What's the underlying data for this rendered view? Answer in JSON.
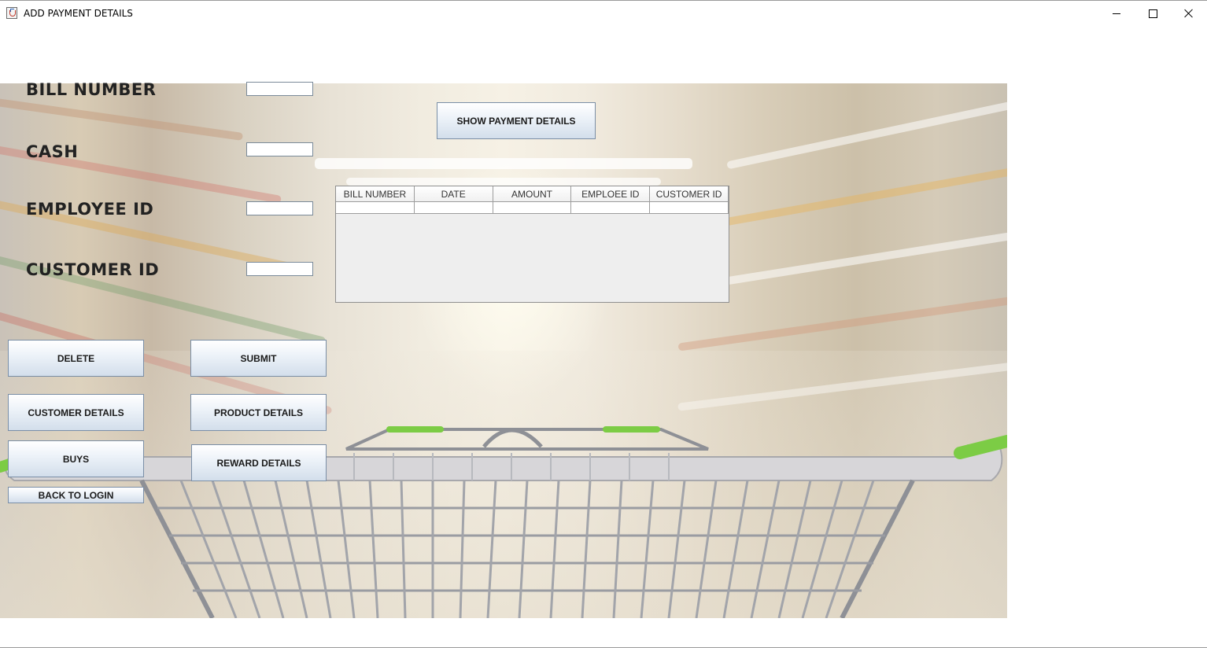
{
  "window": {
    "title": "ADD PAYMENT DETAILS",
    "icon": "java-app-icon",
    "controls": [
      "minimize-icon",
      "maximize-icon",
      "close-icon"
    ]
  },
  "form": {
    "bill_number_label": "BILL NUMBER",
    "bill_number_value": "",
    "cash_label": "CASH",
    "cash_value": "",
    "employee_id_label": "EMPLOYEE ID",
    "employee_id_value": "",
    "customer_id_label": "CUSTOMER ID",
    "customer_id_value": ""
  },
  "buttons": {
    "show_payment_details": "SHOW PAYMENT DETAILS",
    "delete": "DELETE",
    "submit": "SUBMIT",
    "customer_details": "CUSTOMER DETAILS",
    "product_details": "PRODUCT DETAILS",
    "buys": "BUYS",
    "reward_details": "REWARD DETAILS",
    "back_to_login": "BACK TO LOGIN"
  },
  "table": {
    "columns": [
      "BILL NUMBER",
      "DATE",
      "AMOUNT",
      "EMPLOEE ID",
      "CUSTOMER ID"
    ],
    "rows": [
      [
        "",
        "",
        "",
        "",
        ""
      ]
    ]
  },
  "colors": {
    "cart_green": "#7ccc45",
    "cart_frame": "#8e9096",
    "button_border": "#7a8ea6"
  }
}
